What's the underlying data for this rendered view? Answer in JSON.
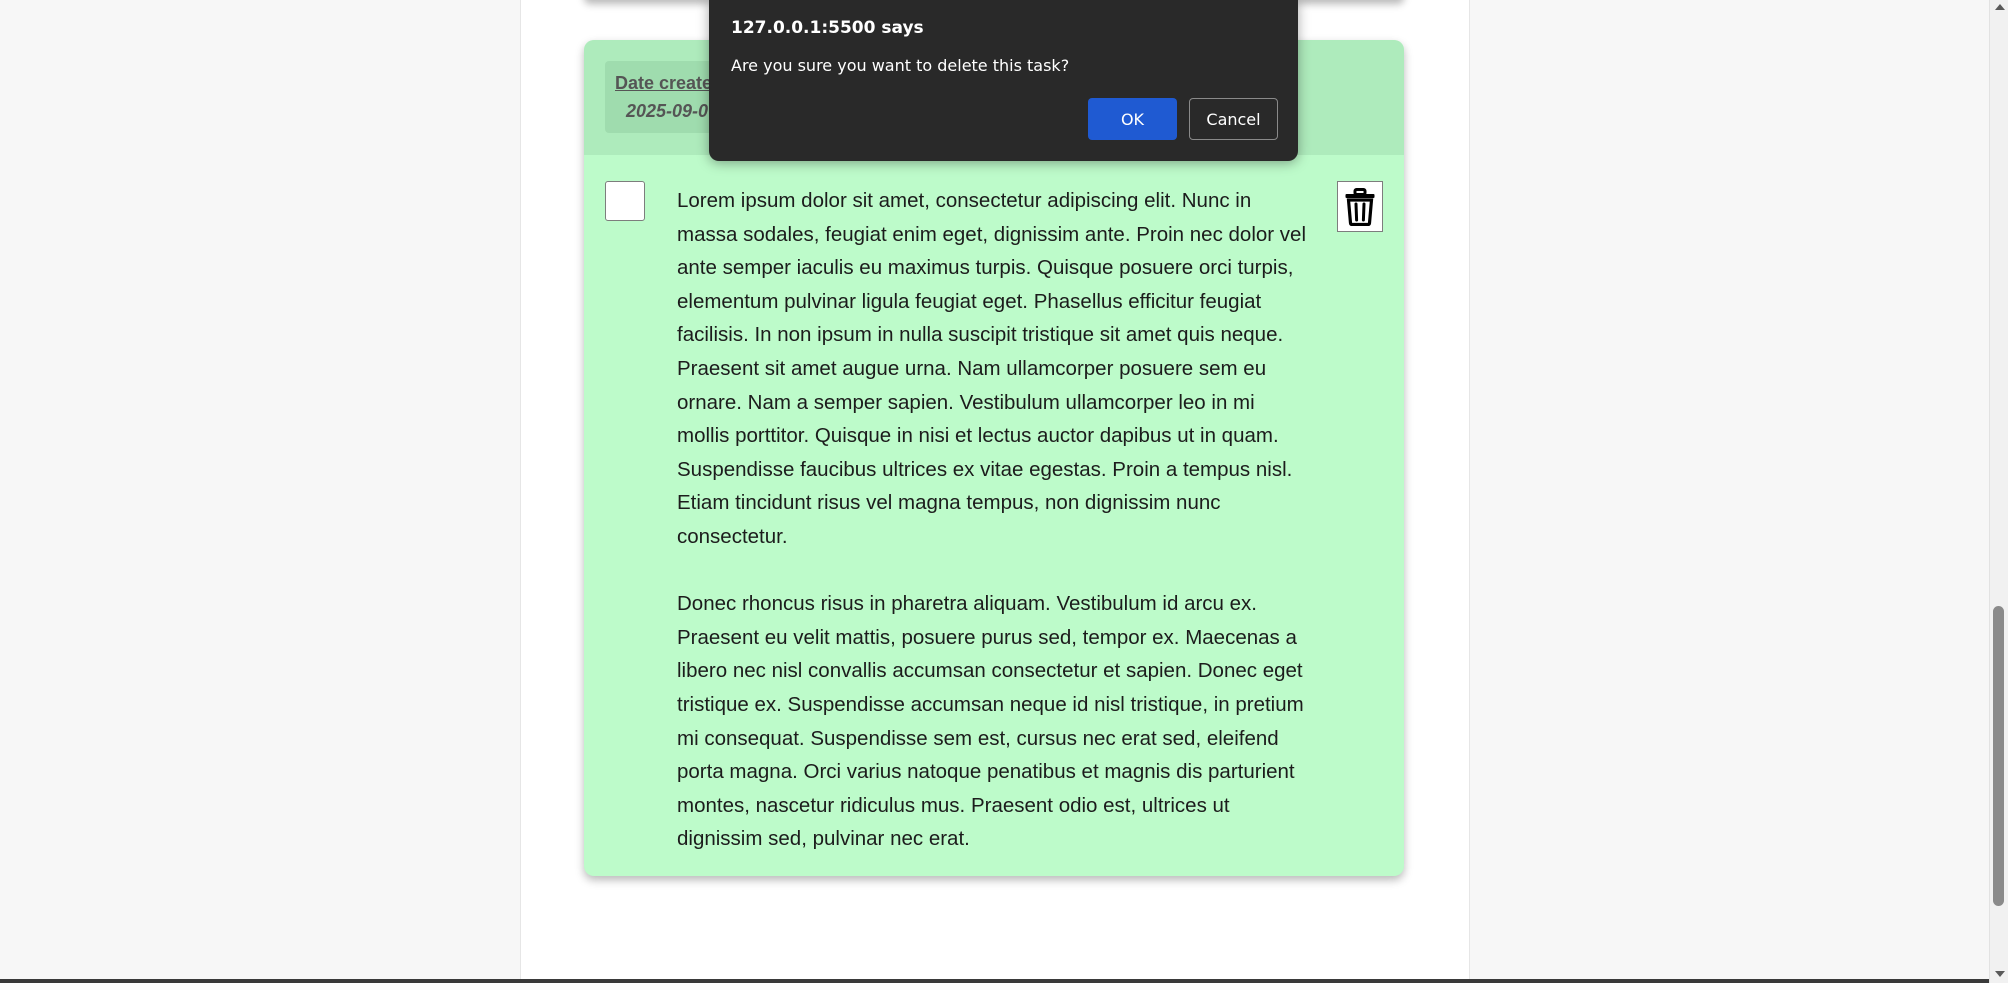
{
  "dialog": {
    "title": "127.0.0.1:5500 says",
    "message": "Are you sure you want to delete this task?",
    "ok_label": "OK",
    "cancel_label": "Cancel",
    "ok_color": "#1f5ad2"
  },
  "task": {
    "date_label": "Date created:",
    "date_value": "2025-09-0",
    "card_color": "#bdfbca",
    "header_color": "#aeebbc",
    "paragraphs": [
      "Lorem ipsum dolor sit amet, consectetur adipiscing elit. Nunc in massa sodales, feugiat enim eget, dignissim ante. Proin nec dolor vel ante semper iaculis eu maximus turpis. Quisque posuere orci turpis, elementum pulvinar ligula feugiat eget. Phasellus efficitur feugiat facilisis. In non ipsum in nulla suscipit tristique sit amet quis neque. Praesent sit amet augue urna. Nam ullamcorper posuere sem eu ornare. Nam a semper sapien. Vestibulum ullamcorper leo in mi mollis porttitor. Quisque in nisi et lectus auctor dapibus ut in quam. Suspendisse faucibus ultrices ex vitae egestas. Proin a tempus nisl. Etiam tincidunt risus vel magna tempus, non dignissim nunc consectetur.",
      "Donec rhoncus risus in pharetra aliquam. Vestibulum id arcu ex. Praesent eu velit mattis, posuere purus sed, tempor ex. Maecenas a libero nec nisl convallis accumsan consectetur et sapien. Donec eget tristique ex. Suspendisse accumsan neque id nisl tristique, in pretium mi consequat. Suspendisse sem est, cursus nec erat sed, eleifend porta magna. Orci varius natoque penatibus et magnis dis parturient montes, nascetur ridiculus mus. Praesent odio est, ultrices ut dignissim sed, pulvinar nec erat."
    ],
    "completed": false
  },
  "icons": {
    "delete": "trash-icon"
  }
}
